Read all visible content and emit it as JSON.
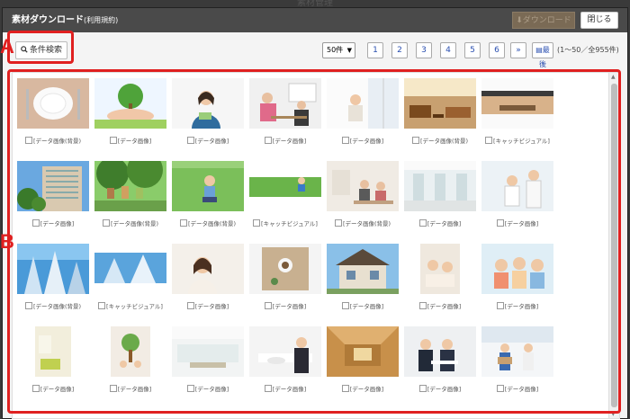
{
  "background_title": "素材管理",
  "dialog": {
    "title": "素材ダウンロード",
    "title_suffix": "(利用規約)",
    "download_label": "ダウンロード",
    "close_label": "閉じる"
  },
  "toolbar": {
    "search_label": "条件検索",
    "per_page": "50件",
    "pages": [
      "1",
      "2",
      "3",
      "4",
      "5",
      "6",
      "»"
    ],
    "last_label": "最後",
    "count_text": "(1〜50／全955件)"
  },
  "annotations": {
    "a": "A",
    "b": "B"
  },
  "items": [
    {
      "label": "[データ画像(背景)",
      "scene": "plate"
    },
    {
      "label": "[データ画像]",
      "scene": "tree"
    },
    {
      "label": "[データ画像]",
      "scene": "woman"
    },
    {
      "label": "[データ画像]",
      "scene": "office"
    },
    {
      "label": "[データ画像]",
      "scene": "window"
    },
    {
      "label": "[データ画像(背景)",
      "scene": "lounge"
    },
    {
      "label": "[キャッチビジュアル]",
      "scene": "room"
    },
    {
      "label": "[データ画像]",
      "scene": "building"
    },
    {
      "label": "[データ画像(背景)",
      "scene": "forest"
    },
    {
      "label": "[データ画像(背景)",
      "scene": "grass"
    },
    {
      "label": "[キャッチビジュアル]",
      "scene": "grass2"
    },
    {
      "label": "[データ画像(背景)",
      "scene": "kitchen"
    },
    {
      "label": "[データ画像]",
      "scene": "hall"
    },
    {
      "label": "[データ画像]",
      "scene": "doctor"
    },
    {
      "label": "[データ画像(背景)",
      "scene": "sky"
    },
    {
      "label": "[キャッチビジュアル]",
      "scene": "sky2"
    },
    {
      "label": "[データ画像]",
      "scene": "woman2"
    },
    {
      "label": "[データ画像]",
      "scene": "table"
    },
    {
      "label": "[データ画像]",
      "scene": "house"
    },
    {
      "label": "[データ画像]",
      "scene": "family"
    },
    {
      "label": "[データ画像]",
      "scene": "kids"
    },
    {
      "label": "[データ画像]",
      "scene": "room2"
    },
    {
      "label": "[データ画像]",
      "scene": "child"
    },
    {
      "label": "[データ画像]",
      "scene": "living"
    },
    {
      "label": "[データ画像]",
      "scene": "meeting"
    },
    {
      "label": "[データ画像]",
      "scene": "wood"
    },
    {
      "label": "[データ画像]",
      "scene": "business"
    },
    {
      "label": "[データ画像]",
      "scene": "delivery"
    }
  ],
  "colors": {
    "accent": "#e02020",
    "link": "#2a4fb0"
  }
}
